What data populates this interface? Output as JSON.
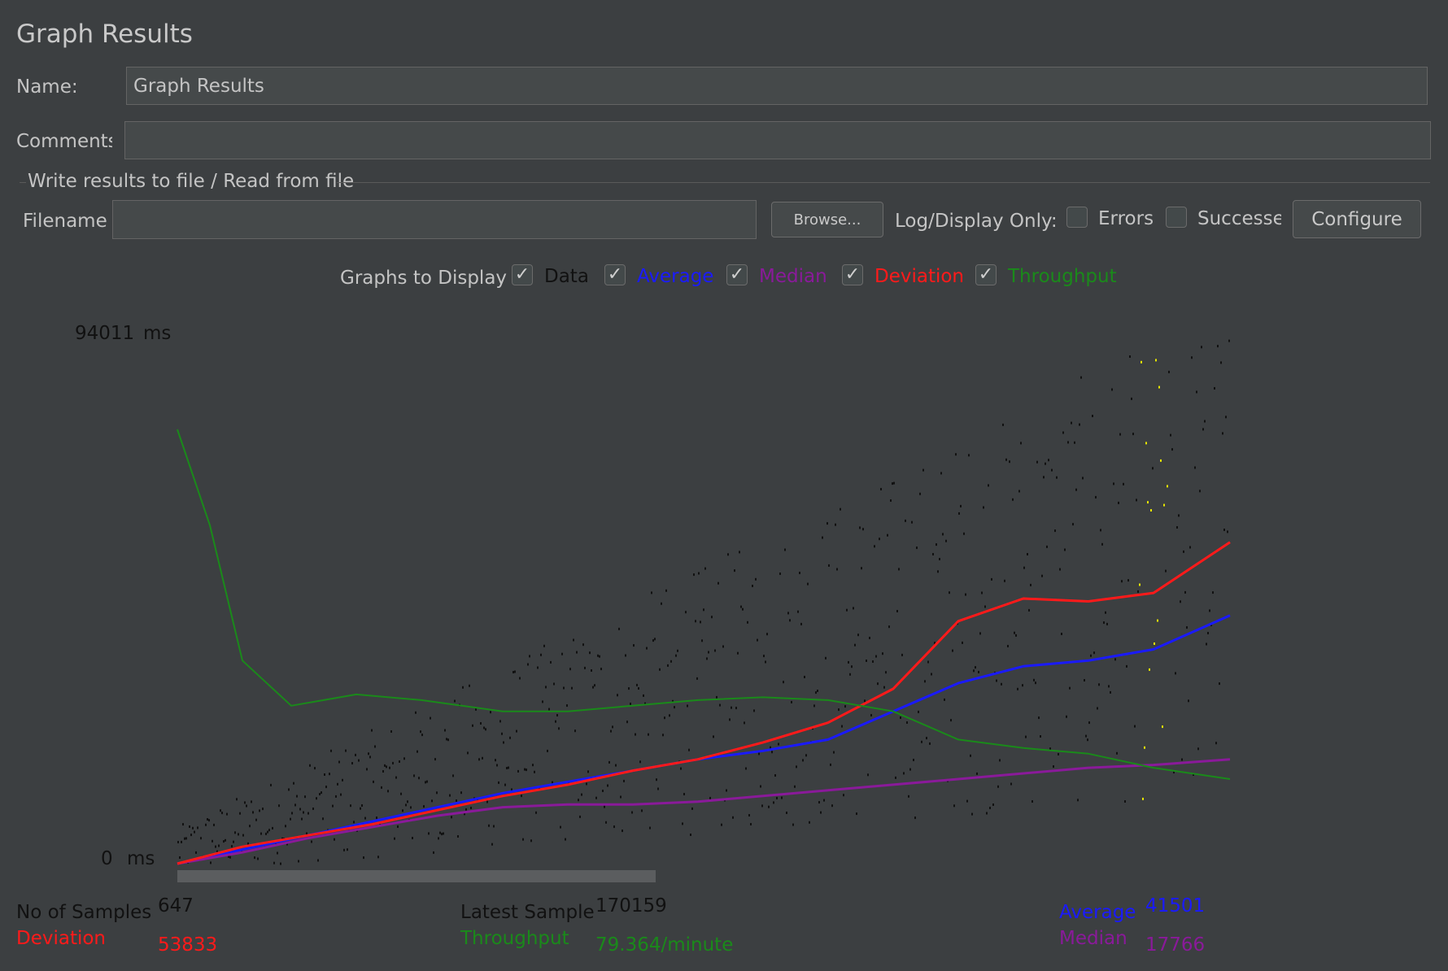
{
  "window": {
    "title": "Graph Results"
  },
  "form": {
    "name_label": "Name:",
    "name_value": "Graph Results",
    "comments_label": "Comments:",
    "comments_value": "",
    "file_group_title": "Write results to file / Read from file",
    "filename_label": "Filename",
    "filename_value": "",
    "browse_label": "Browse...",
    "log_display_label": "Log/Display Only:",
    "errors_label": "Errors",
    "errors_checked": false,
    "successes_label": "Successes",
    "successes_checked": false,
    "configure_label": "Configure"
  },
  "graphs_to_display": {
    "label": "Graphs to Display",
    "options": [
      {
        "label": "Data",
        "checked": true,
        "color": "#111111"
      },
      {
        "label": "Average",
        "checked": true,
        "color": "#1a1aff"
      },
      {
        "label": "Median",
        "checked": true,
        "color": "#8a1a9a"
      },
      {
        "label": "Deviation",
        "checked": true,
        "color": "#ff1a1a"
      },
      {
        "label": "Throughput",
        "checked": true,
        "color": "#1a8a1a"
      }
    ]
  },
  "graph": {
    "y_max_label": "94011",
    "y_min_label": "0",
    "unit": "ms"
  },
  "stats": {
    "samples_label": "No of Samples",
    "samples_value": "647",
    "latest_label": "Latest Sample",
    "latest_value": "170159",
    "average_label": "Average",
    "average_value": "41501",
    "deviation_label": "Deviation",
    "deviation_value": "53833",
    "throughput_label": "Throughput",
    "throughput_value": "79.364/minute",
    "median_label": "Median",
    "median_value": "17766"
  },
  "colors": {
    "background": "#3c3f41",
    "data": "#111111",
    "average": "#1a1aff",
    "median": "#8a1a9a",
    "deviation": "#ff1a1a",
    "throughput": "#1a8a1a",
    "highlight": "#e6e600"
  },
  "chart_data": {
    "type": "line",
    "ylim": [
      0,
      94011
    ],
    "y_unit": "ms",
    "x_label": "",
    "series": [
      {
        "name": "Average",
        "x": [
          0,
          40,
          80,
          120,
          160,
          200,
          240,
          280,
          320,
          360,
          400,
          440,
          480,
          520,
          560,
          600,
          647
        ],
        "values": [
          0,
          2500,
          5000,
          7500,
          10000,
          12500,
          14500,
          16500,
          18500,
          20000,
          22000,
          27000,
          32000,
          35000,
          36000,
          38000,
          44000
        ]
      },
      {
        "name": "Median",
        "x": [
          0,
          40,
          80,
          120,
          160,
          200,
          240,
          280,
          320,
          360,
          400,
          440,
          480,
          520,
          560,
          600,
          647
        ],
        "values": [
          0,
          2000,
          4500,
          6500,
          8500,
          10000,
          10500,
          10500,
          11000,
          12000,
          13000,
          14000,
          15000,
          16000,
          17000,
          17500,
          18500
        ]
      },
      {
        "name": "Deviation",
        "x": [
          0,
          40,
          80,
          120,
          160,
          200,
          240,
          280,
          320,
          360,
          400,
          440,
          480,
          520,
          560,
          600,
          647
        ],
        "values": [
          0,
          3000,
          5000,
          7000,
          9500,
          12000,
          14000,
          16500,
          18500,
          21500,
          25000,
          31000,
          43000,
          47000,
          46500,
          48000,
          57000
        ]
      },
      {
        "name": "Throughput",
        "x": [
          0,
          20,
          40,
          70,
          110,
          150,
          200,
          240,
          280,
          320,
          360,
          400,
          440,
          480,
          520,
          560,
          600,
          647
        ],
        "values": [
          77000,
          60000,
          36000,
          28000,
          30000,
          29000,
          27000,
          27000,
          28000,
          29000,
          29500,
          29000,
          27000,
          22000,
          20500,
          19500,
          17000,
          15000
        ]
      }
    ]
  }
}
